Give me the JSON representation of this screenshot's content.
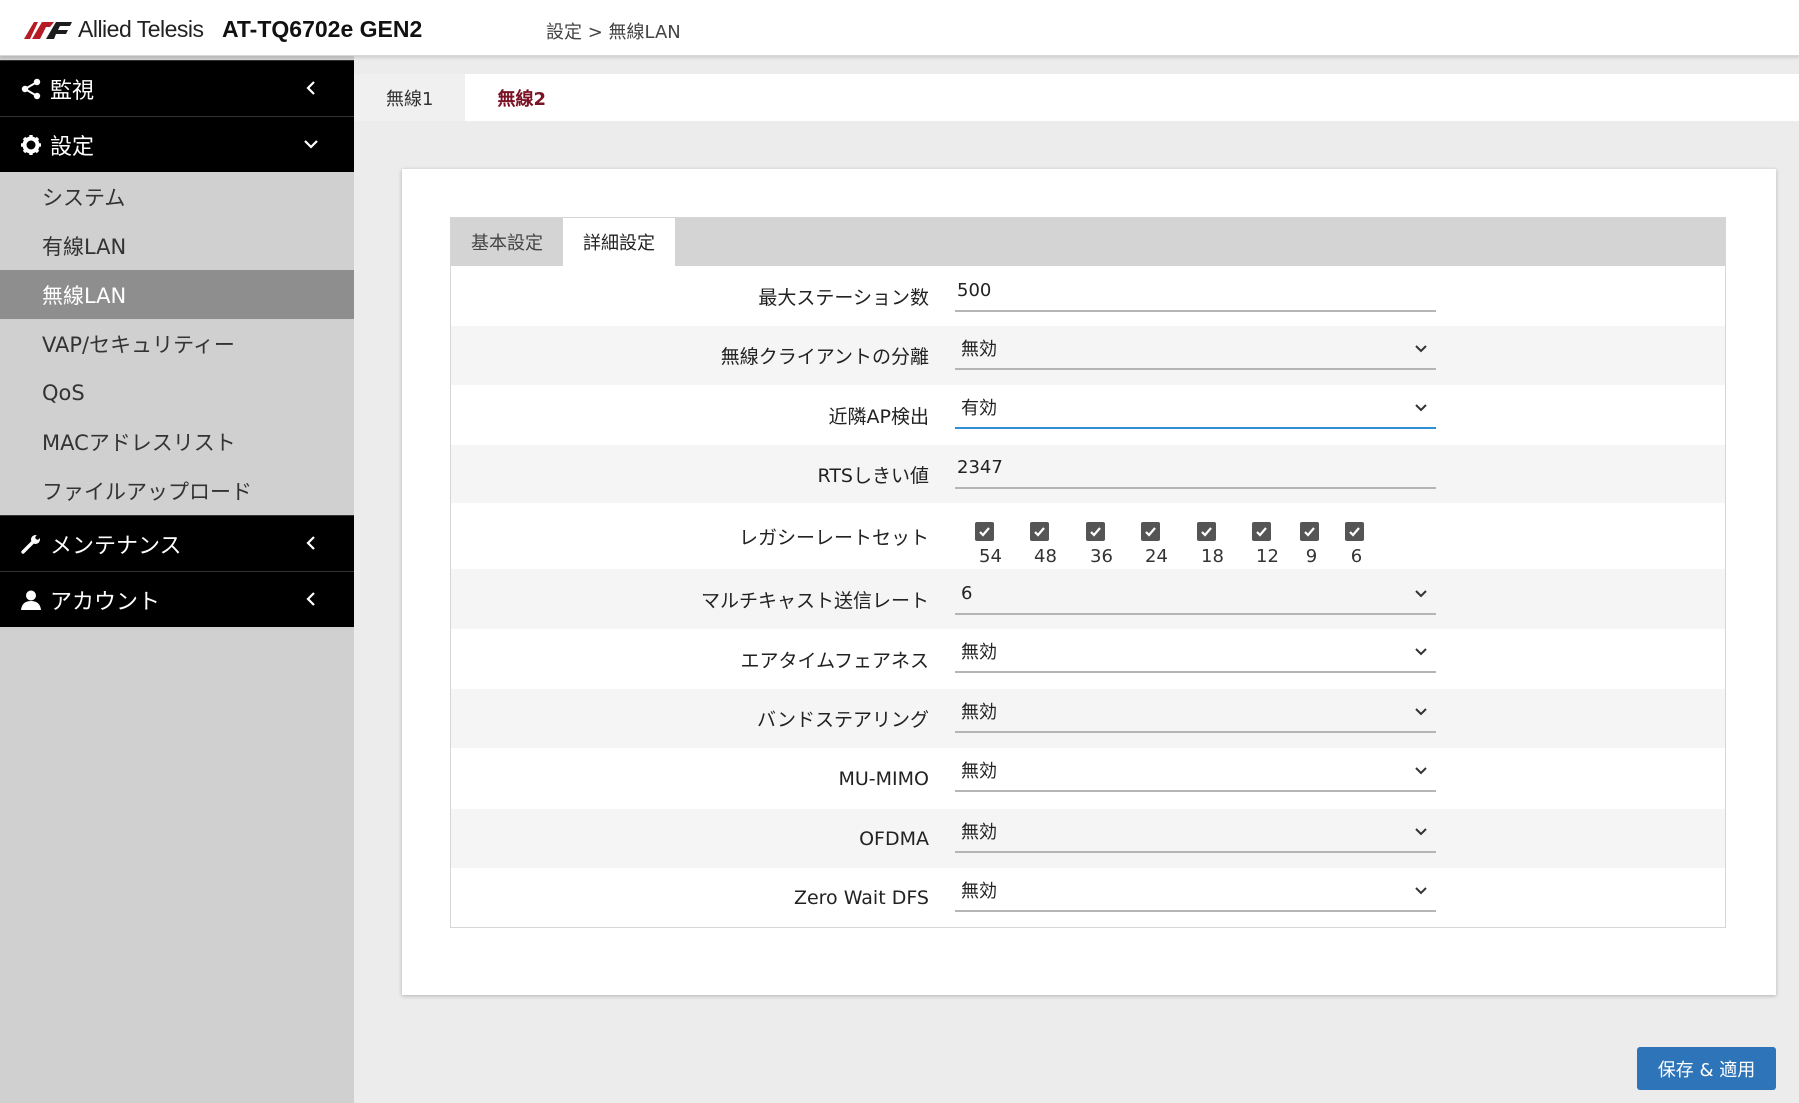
{
  "header": {
    "brand": "Allied Telesis",
    "model": "AT-TQ6702e GEN2",
    "breadcrumb": "設定 > 無線LAN"
  },
  "sidebar": {
    "groups": [
      {
        "label": "監視",
        "icon": "share-icon"
      },
      {
        "label": "設定",
        "icon": "gear-icon"
      },
      {
        "label": "メンテナンス",
        "icon": "wrench-icon"
      },
      {
        "label": "アカウント",
        "icon": "user-icon"
      }
    ],
    "items": [
      "システム",
      "有線LAN",
      "無線LAN",
      "VAP/セキュリティー",
      "QoS",
      "MACアドレスリスト",
      "ファイルアップロード"
    ],
    "active_item": "無線LAN"
  },
  "radio_tabs": [
    "無線1",
    "無線2"
  ],
  "active_radio_tab": "無線2",
  "settings_tabs": [
    "基本設定",
    "詳細設定"
  ],
  "active_settings_tab": "詳細設定",
  "form": {
    "max_stations": {
      "label": "最大ステーション数",
      "value": "500"
    },
    "client_isolation": {
      "label": "無線クライアントの分離",
      "value": "無効"
    },
    "neighbor_ap": {
      "label": "近隣AP検出",
      "value": "有効"
    },
    "rts_threshold": {
      "label": "RTSしきい値",
      "value": "2347"
    },
    "legacy_rates": {
      "label": "レガシーレートセット",
      "rates": [
        "54",
        "48",
        "36",
        "24",
        "18",
        "12",
        "9",
        "6"
      ],
      "all_checked": true
    },
    "multicast_rate": {
      "label": "マルチキャスト送信レート",
      "value": "6"
    },
    "airtime_fairness": {
      "label": "エアタイムフェアネス",
      "value": "無効"
    },
    "band_steering": {
      "label": "バンドステアリング",
      "value": "無効"
    },
    "mu_mimo": {
      "label": "MU-MIMO",
      "value": "無効"
    },
    "ofdma": {
      "label": "OFDMA",
      "value": "無効"
    },
    "zero_wait_dfs": {
      "label": "Zero Wait DFS",
      "value": "無効"
    }
  },
  "save_button": "保存 & 適用",
  "colors": {
    "accent_tab": "#7a1325",
    "focus": "#2f8fd6",
    "button": "#2e74b8"
  }
}
